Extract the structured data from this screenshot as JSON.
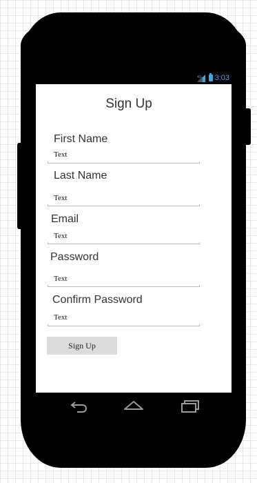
{
  "status_bar": {
    "time": "3:03",
    "signal_icon": "signal-icon",
    "battery_icon": "battery-icon"
  },
  "form": {
    "title": "Sign Up",
    "fields": [
      {
        "label": "First Name",
        "value": "Text"
      },
      {
        "label": "Last Name",
        "value": "Text"
      },
      {
        "label": "Email",
        "value": "Text"
      },
      {
        "label": "Password",
        "value": "Text"
      },
      {
        "label": "Confirm Password",
        "value": "Text"
      }
    ],
    "submit_label": "Sign Up"
  },
  "nav_bar": {
    "icons": [
      "back-icon",
      "home-icon",
      "recents-icon"
    ]
  },
  "colors": {
    "device": "#000000",
    "status_accent": "#3aa7e4",
    "button_bg": "#dcdcdc",
    "screen_bg": "#ffffff"
  }
}
